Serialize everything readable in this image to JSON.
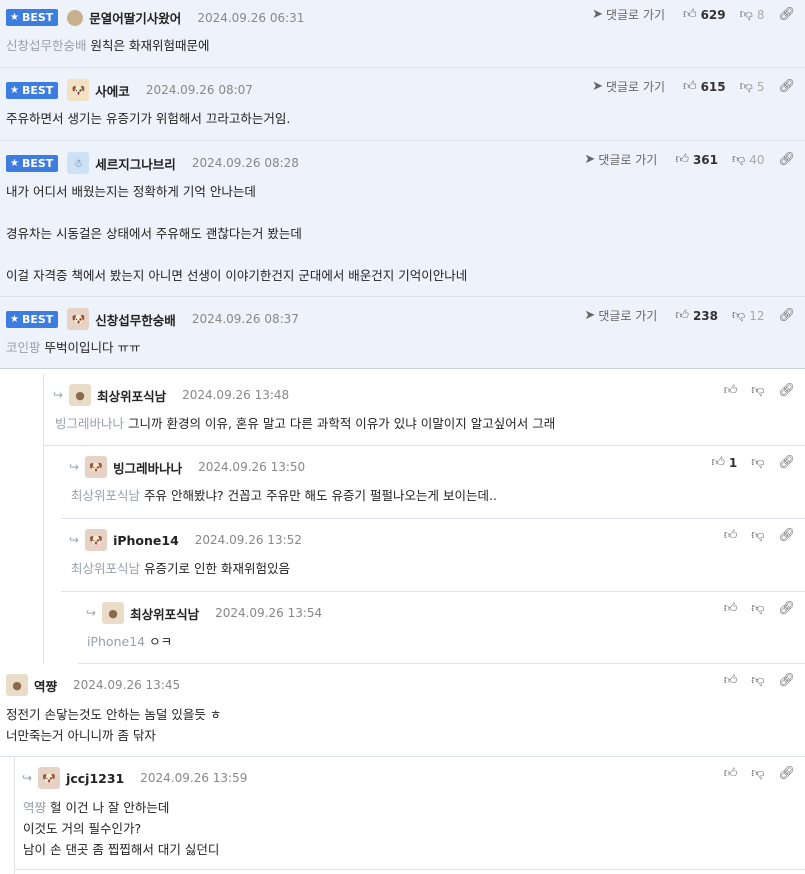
{
  "labels": {
    "best": "BEST",
    "goto_reply": "댓글로 가기"
  },
  "best_comments": [
    {
      "author": "문열어딸기사왔어",
      "date": "2024.09.26 06:31",
      "mention": "신창섭무한숭배",
      "lines": [
        "원칙은 화재위험때문에"
      ],
      "up": "629",
      "down": "8"
    },
    {
      "author": "사에코",
      "date": "2024.09.26 08:07",
      "mention": "",
      "lines": [
        "주유하면서 생기는 유증기가 위험해서 끄라고하는거임."
      ],
      "up": "615",
      "down": "5"
    },
    {
      "author": "세르지그나브리",
      "date": "2024.09.26 08:28",
      "mention": "",
      "lines": [
        "내가 어디서 배웠는지는 정확하게 기억 안나는데",
        "경유차는 시동걸은 상태에서 주유해도 괜찮다는거 봤는데",
        "이걸 자격증 책에서 봤는지 아니면 선생이 이야기한건지 군대에서 배운건지 기억이안나네"
      ],
      "up": "361",
      "down": "40"
    },
    {
      "author": "신창섭무한숭배",
      "date": "2024.09.26 08:37",
      "mention": "코인팡",
      "lines": [
        "뚜벅이입니다 ㅠㅠ"
      ],
      "up": "238",
      "down": "12"
    }
  ],
  "replies": [
    {
      "author": "최상위포식남",
      "date": "2024.09.26 13:48",
      "mention": "빙그레바나나",
      "lines": [
        "그니까 환경의 이유, 혼유 말고 다른 과학적 이유가 있냐 이말이지 알고싶어서 그래"
      ],
      "up": ""
    },
    {
      "author": "빙그레바나나",
      "date": "2024.09.26 13:50",
      "mention": "최상위포식남",
      "lines": [
        "주유 안해봤냐? 건꼽고 주유만 해도 유증기 펄펄나오는게 보이는데.."
      ],
      "up": "1"
    },
    {
      "author": "iPhone14",
      "date": "2024.09.26 13:52",
      "mention": "최상위포식남",
      "lines": [
        "유증기로 인한 화재위험있음"
      ],
      "up": ""
    },
    {
      "author": "최상위포식남",
      "date": "2024.09.26 13:54",
      "mention": "iPhone14",
      "lines": [
        "ㅇㅋ"
      ],
      "up": ""
    },
    {
      "author": "역쨩",
      "date": "2024.09.26 13:45",
      "mention": "",
      "lines": [
        "정전기 손닿는것도 안하는 놈덜 있을듯 ㅎ",
        "너만죽는거 아니니까 좀 닦자"
      ],
      "up": ""
    },
    {
      "author": "jccj1231",
      "date": "2024.09.26 13:59",
      "mention": "역쨩",
      "lines": [
        "헐 이건 나 잘 안하는데",
        "이것도 거의 필수인가?",
        "남이 손 댄곳 좀 찝찝해서 대기 싫던디"
      ],
      "up": ""
    }
  ]
}
